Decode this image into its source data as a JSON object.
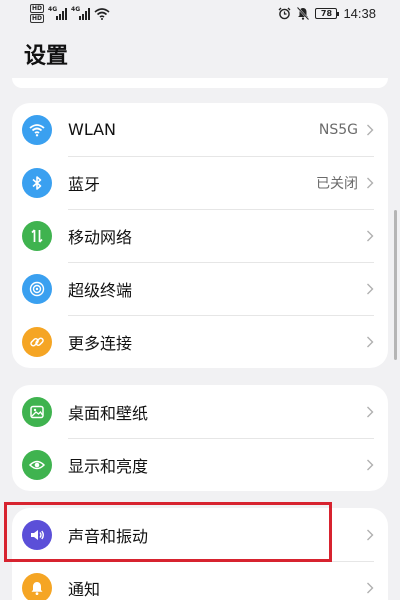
{
  "status_bar": {
    "hd1": "HD",
    "hd2": "HD",
    "net1": "4G",
    "net2": "4G",
    "battery": "78",
    "time": "14:38"
  },
  "page": {
    "title": "设置"
  },
  "groups": [
    {
      "items": [
        {
          "label": "WLAN",
          "value": "NS5G",
          "icon": "wifi-icon",
          "color": "#3aa0f0"
        },
        {
          "label": "蓝牙",
          "value": "已关闭",
          "icon": "bluetooth-icon",
          "color": "#3aa0f0"
        },
        {
          "label": "移动网络",
          "value": "",
          "icon": "mobile-data-icon",
          "color": "#3fb34f"
        },
        {
          "label": "超级终端",
          "value": "",
          "icon": "super-device-icon",
          "color": "#3aa0f0"
        },
        {
          "label": "更多连接",
          "value": "",
          "icon": "link-icon",
          "color": "#f5a524"
        }
      ]
    },
    {
      "items": [
        {
          "label": "桌面和壁纸",
          "value": "",
          "icon": "wallpaper-icon",
          "color": "#3fb34f"
        },
        {
          "label": "显示和亮度",
          "value": "",
          "icon": "eye-icon",
          "color": "#3fb34f"
        }
      ]
    },
    {
      "items": [
        {
          "label": "声音和振动",
          "value": "",
          "icon": "sound-icon",
          "color": "#5b4fd8"
        },
        {
          "label": "通知",
          "value": "",
          "icon": "bell-icon",
          "color": "#f5a524"
        }
      ]
    }
  ]
}
